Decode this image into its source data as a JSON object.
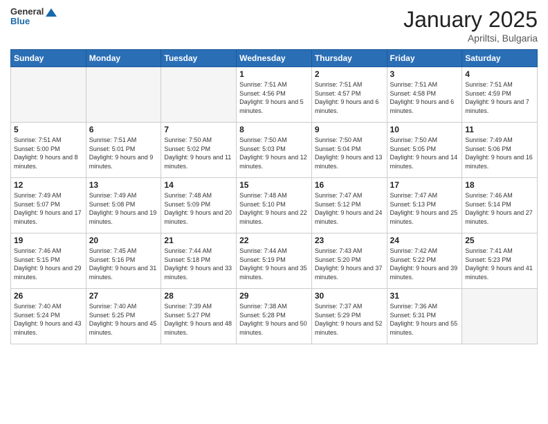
{
  "logo": {
    "general": "General",
    "blue": "Blue"
  },
  "header": {
    "title": "January 2025",
    "location": "Apriltsi, Bulgaria"
  },
  "weekdays": [
    "Sunday",
    "Monday",
    "Tuesday",
    "Wednesday",
    "Thursday",
    "Friday",
    "Saturday"
  ],
  "weeks": [
    [
      {
        "day": "",
        "empty": true
      },
      {
        "day": "",
        "empty": true
      },
      {
        "day": "",
        "empty": true
      },
      {
        "day": "1",
        "sunrise": "7:51 AM",
        "sunset": "4:56 PM",
        "daylight": "9 hours and 5 minutes."
      },
      {
        "day": "2",
        "sunrise": "7:51 AM",
        "sunset": "4:57 PM",
        "daylight": "9 hours and 6 minutes."
      },
      {
        "day": "3",
        "sunrise": "7:51 AM",
        "sunset": "4:58 PM",
        "daylight": "9 hours and 6 minutes."
      },
      {
        "day": "4",
        "sunrise": "7:51 AM",
        "sunset": "4:59 PM",
        "daylight": "9 hours and 7 minutes."
      }
    ],
    [
      {
        "day": "5",
        "sunrise": "7:51 AM",
        "sunset": "5:00 PM",
        "daylight": "9 hours and 8 minutes."
      },
      {
        "day": "6",
        "sunrise": "7:51 AM",
        "sunset": "5:01 PM",
        "daylight": "9 hours and 9 minutes."
      },
      {
        "day": "7",
        "sunrise": "7:50 AM",
        "sunset": "5:02 PM",
        "daylight": "9 hours and 11 minutes."
      },
      {
        "day": "8",
        "sunrise": "7:50 AM",
        "sunset": "5:03 PM",
        "daylight": "9 hours and 12 minutes."
      },
      {
        "day": "9",
        "sunrise": "7:50 AM",
        "sunset": "5:04 PM",
        "daylight": "9 hours and 13 minutes."
      },
      {
        "day": "10",
        "sunrise": "7:50 AM",
        "sunset": "5:05 PM",
        "daylight": "9 hours and 14 minutes."
      },
      {
        "day": "11",
        "sunrise": "7:49 AM",
        "sunset": "5:06 PM",
        "daylight": "9 hours and 16 minutes."
      }
    ],
    [
      {
        "day": "12",
        "sunrise": "7:49 AM",
        "sunset": "5:07 PM",
        "daylight": "9 hours and 17 minutes."
      },
      {
        "day": "13",
        "sunrise": "7:49 AM",
        "sunset": "5:08 PM",
        "daylight": "9 hours and 19 minutes."
      },
      {
        "day": "14",
        "sunrise": "7:48 AM",
        "sunset": "5:09 PM",
        "daylight": "9 hours and 20 minutes."
      },
      {
        "day": "15",
        "sunrise": "7:48 AM",
        "sunset": "5:10 PM",
        "daylight": "9 hours and 22 minutes."
      },
      {
        "day": "16",
        "sunrise": "7:47 AM",
        "sunset": "5:12 PM",
        "daylight": "9 hours and 24 minutes."
      },
      {
        "day": "17",
        "sunrise": "7:47 AM",
        "sunset": "5:13 PM",
        "daylight": "9 hours and 25 minutes."
      },
      {
        "day": "18",
        "sunrise": "7:46 AM",
        "sunset": "5:14 PM",
        "daylight": "9 hours and 27 minutes."
      }
    ],
    [
      {
        "day": "19",
        "sunrise": "7:46 AM",
        "sunset": "5:15 PM",
        "daylight": "9 hours and 29 minutes."
      },
      {
        "day": "20",
        "sunrise": "7:45 AM",
        "sunset": "5:16 PM",
        "daylight": "9 hours and 31 minutes."
      },
      {
        "day": "21",
        "sunrise": "7:44 AM",
        "sunset": "5:18 PM",
        "daylight": "9 hours and 33 minutes."
      },
      {
        "day": "22",
        "sunrise": "7:44 AM",
        "sunset": "5:19 PM",
        "daylight": "9 hours and 35 minutes."
      },
      {
        "day": "23",
        "sunrise": "7:43 AM",
        "sunset": "5:20 PM",
        "daylight": "9 hours and 37 minutes."
      },
      {
        "day": "24",
        "sunrise": "7:42 AM",
        "sunset": "5:22 PM",
        "daylight": "9 hours and 39 minutes."
      },
      {
        "day": "25",
        "sunrise": "7:41 AM",
        "sunset": "5:23 PM",
        "daylight": "9 hours and 41 minutes."
      }
    ],
    [
      {
        "day": "26",
        "sunrise": "7:40 AM",
        "sunset": "5:24 PM",
        "daylight": "9 hours and 43 minutes."
      },
      {
        "day": "27",
        "sunrise": "7:40 AM",
        "sunset": "5:25 PM",
        "daylight": "9 hours and 45 minutes."
      },
      {
        "day": "28",
        "sunrise": "7:39 AM",
        "sunset": "5:27 PM",
        "daylight": "9 hours and 48 minutes."
      },
      {
        "day": "29",
        "sunrise": "7:38 AM",
        "sunset": "5:28 PM",
        "daylight": "9 hours and 50 minutes."
      },
      {
        "day": "30",
        "sunrise": "7:37 AM",
        "sunset": "5:29 PM",
        "daylight": "9 hours and 52 minutes."
      },
      {
        "day": "31",
        "sunrise": "7:36 AM",
        "sunset": "5:31 PM",
        "daylight": "9 hours and 55 minutes."
      },
      {
        "day": "",
        "empty": true
      }
    ]
  ]
}
